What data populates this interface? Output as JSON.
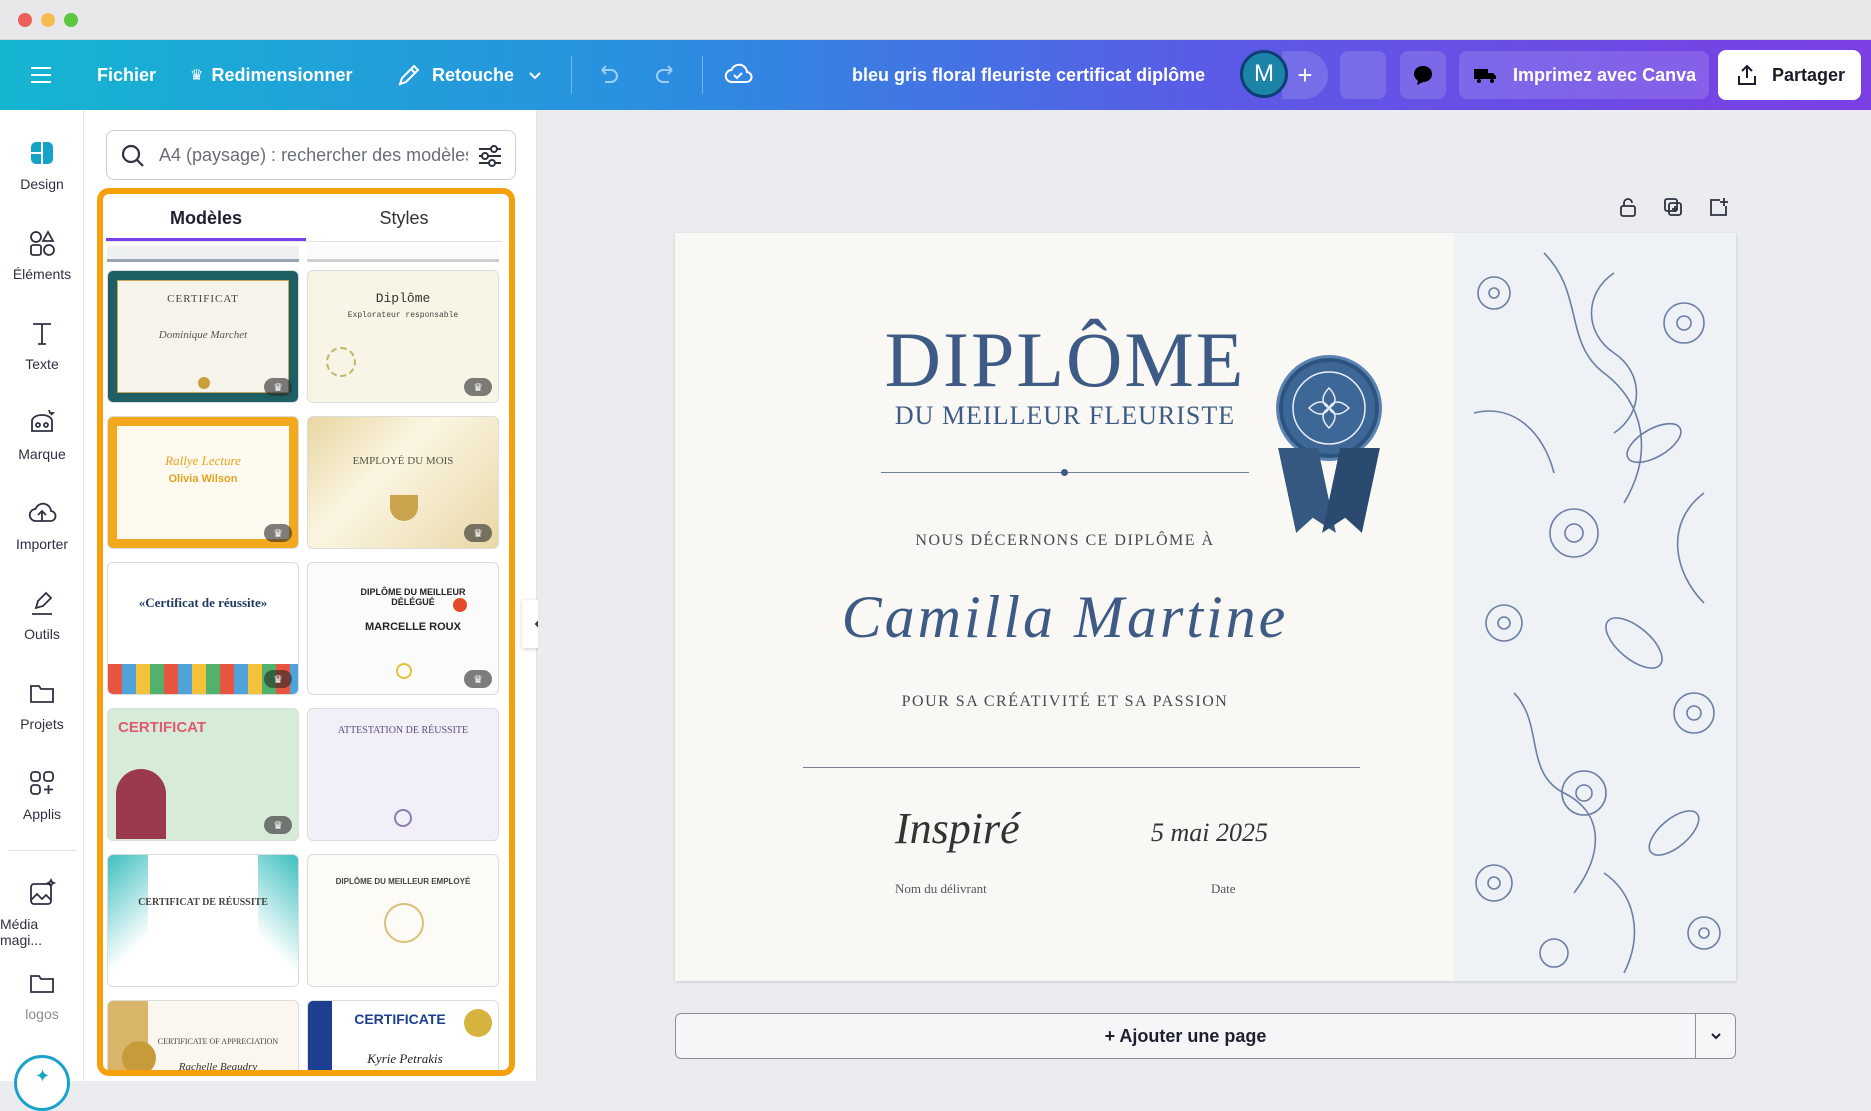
{
  "topbar": {
    "file": "Fichier",
    "resize": "Redimensionner",
    "retouch": "Retouche",
    "doc_title": "bleu gris floral fleuriste certificat diplôme",
    "avatar_initial": "M",
    "print": "Imprimez avec Canva",
    "share": "Partager"
  },
  "rail": {
    "items": [
      {
        "label": "Design"
      },
      {
        "label": "Éléments"
      },
      {
        "label": "Texte"
      },
      {
        "label": "Marque"
      },
      {
        "label": "Importer"
      },
      {
        "label": "Outils"
      },
      {
        "label": "Projets"
      },
      {
        "label": "Applis"
      },
      {
        "label": "Média magi..."
      },
      {
        "label": "logos"
      }
    ]
  },
  "panel": {
    "search_placeholder": "A4 (paysage) : rechercher des modèles",
    "tabs": [
      {
        "label": "Modèles"
      },
      {
        "label": "Styles"
      }
    ],
    "cards": [
      {
        "t1": "CERTIFICAT",
        "t2": "Dominique Marchet"
      },
      {
        "t1": "Diplôme",
        "t2": "Explorateur responsable"
      },
      {
        "t1": "Rallye Lecture",
        "t2": "Olivia Wilson"
      },
      {
        "t1": "EMPLOYÉ DU MOIS",
        "t2": ""
      },
      {
        "t1": "«Certificat de réussite»",
        "t2": ""
      },
      {
        "t1": "DIPLÔME DU MEILLEUR DÉLÉGUÉ",
        "t2": "MARCELLE ROUX"
      },
      {
        "t1": "CERTIFICAT",
        "t2": ""
      },
      {
        "t1": "ATTESTATION DE RÉUSSITE",
        "t2": ""
      },
      {
        "t1": "CERTIFICAT DE RÉUSSITE",
        "t2": ""
      },
      {
        "t1": "DIPLÔME DU MEILLEUR EMPLOYÉ",
        "t2": ""
      },
      {
        "t1": "CERTIFICATE OF APPRECIATION",
        "t2": "Rachelle Beaudry"
      },
      {
        "t1": "CERTIFICATE",
        "t2": "Kyrie Petrakis"
      }
    ]
  },
  "certificate": {
    "title": "DIPLÔME",
    "subtitle": "DU MEILLEUR FLEURISTE",
    "award_line": "NOUS DÉCERNONS CE DIPLÔME À",
    "recipient": "Camilla Martine",
    "reason": "POUR SA CRÉATIVITÉ ET SA PASSION",
    "signature": "Inspiré",
    "date_value": "5 mai 2025",
    "issuer_label": "Nom du délivrant",
    "date_label": "Date"
  },
  "add_page": "+ Ajouter une page",
  "colors": {
    "accent": "#7b3fe4",
    "highlight": "#f6a10b",
    "cert_blue": "#3d5b85"
  }
}
